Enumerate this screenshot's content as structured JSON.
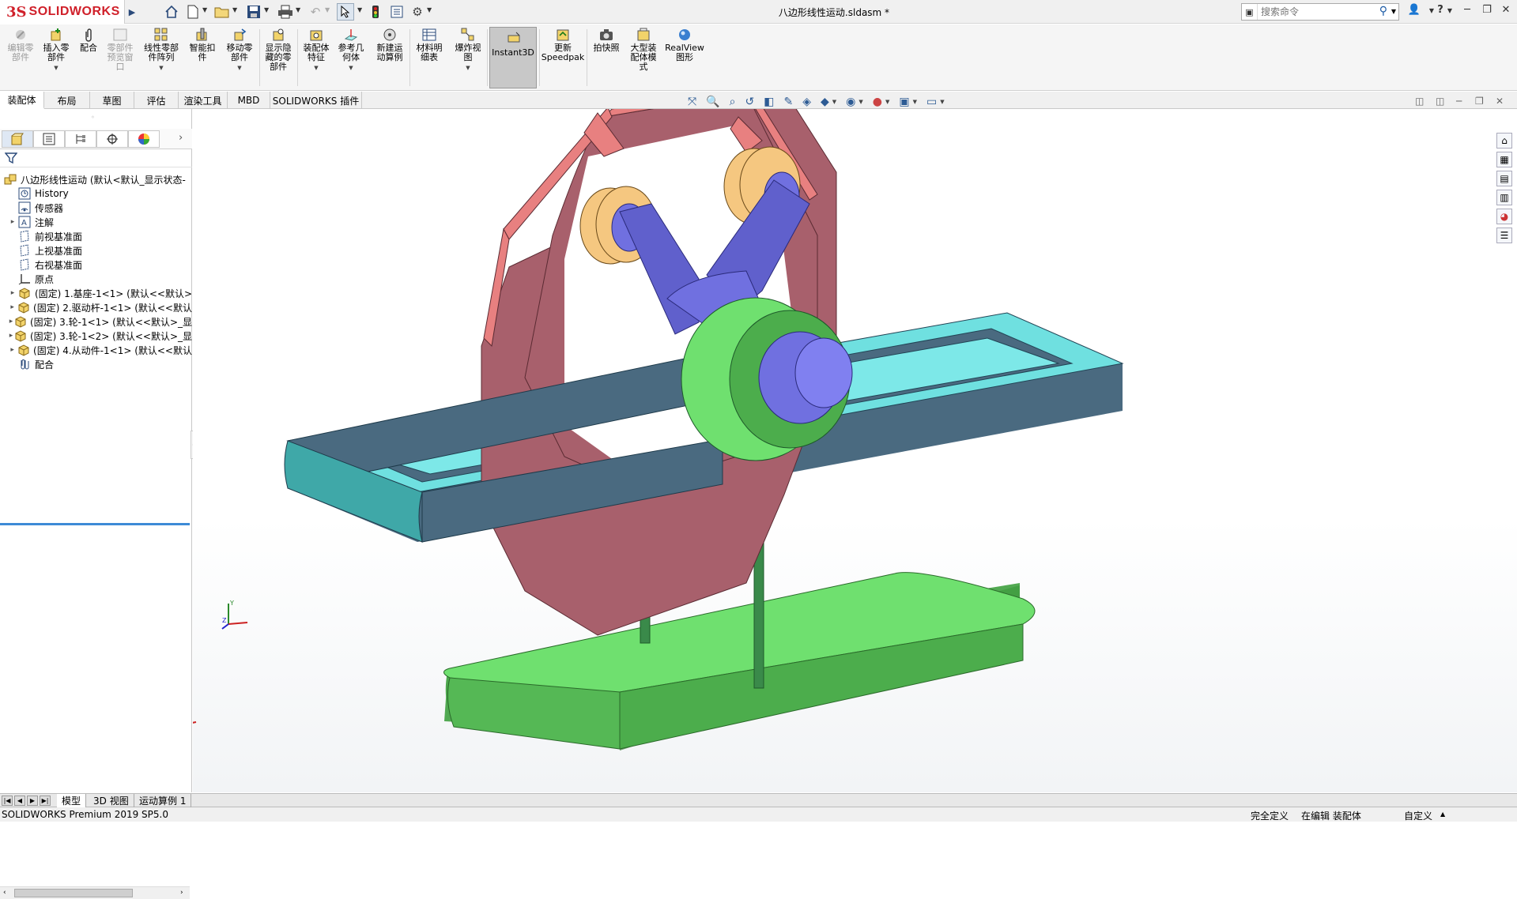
{
  "app": {
    "brand_ds": "3S",
    "brand_name": "SOLIDWORKS"
  },
  "window": {
    "title": "八边形线性运动.sldasm *"
  },
  "search": {
    "placeholder": "搜索命令"
  },
  "commands": [
    {
      "label": "编辑零部件",
      "line1": "编辑零",
      "line2": "部件",
      "enabled": false
    },
    {
      "label": "插入零部件",
      "line1": "插入零",
      "line2": "部件",
      "enabled": true
    },
    {
      "label": "配合",
      "line1": "配合",
      "line2": "",
      "enabled": true
    },
    {
      "label": "零部件预览窗口",
      "line1": "零部件",
      "line2": "预览窗",
      "line3": "口",
      "enabled": false
    },
    {
      "label": "线性零部件阵列",
      "line1": "线性零部",
      "line2": "件阵列",
      "enabled": true
    },
    {
      "label": "智能扣件",
      "line1": "智能扣",
      "line2": "件",
      "enabled": true
    },
    {
      "label": "移动零部件",
      "line1": "移动零",
      "line2": "部件",
      "enabled": true
    },
    {
      "label": "显示隐藏的零部件",
      "line1": "显示隐",
      "line2": "藏的零",
      "line3": "部件",
      "enabled": true
    },
    {
      "label": "装配体特征",
      "line1": "装配体",
      "line2": "特征",
      "enabled": true
    },
    {
      "label": "参考几何体",
      "line1": "参考几",
      "line2": "何体",
      "enabled": true
    },
    {
      "label": "新建运动算例",
      "line1": "新建运",
      "line2": "动算例",
      "enabled": true
    },
    {
      "label": "材料明细表",
      "line1": "材料明",
      "line2": "细表",
      "enabled": true
    },
    {
      "label": "爆炸视图",
      "line1": "爆炸视",
      "line2": "图",
      "enabled": true
    },
    {
      "label": "Instant3D",
      "line1": "Instant3D",
      "line2": "",
      "enabled": true
    },
    {
      "label": "更新Speedpak",
      "line1": "更新",
      "line2": "Speedpak",
      "enabled": true
    },
    {
      "label": "拍快照",
      "line1": "拍快照",
      "line2": "",
      "enabled": true
    },
    {
      "label": "大型装配体模式",
      "line1": "大型装",
      "line2": "配体模",
      "line3": "式",
      "enabled": true
    },
    {
      "label": "RealView图形",
      "line1": "RealView",
      "line2": "图形",
      "enabled": true
    }
  ],
  "ribbon_tabs": [
    "装配体",
    "布局",
    "草图",
    "评估",
    "渲染工具",
    "MBD",
    "SOLIDWORKS 插件"
  ],
  "tree": {
    "root": "八边形线性运动 (默认<默认_显示状态-",
    "items": [
      {
        "label": "History",
        "icon": "history-icon",
        "expand": false
      },
      {
        "label": "传感器",
        "icon": "sensor-icon",
        "expand": false
      },
      {
        "label": "注解",
        "icon": "annotation-icon",
        "expand": true
      },
      {
        "label": "前视基准面",
        "icon": "plane-icon",
        "expand": false
      },
      {
        "label": "上视基准面",
        "icon": "plane-icon",
        "expand": false
      },
      {
        "label": "右视基准面",
        "icon": "plane-icon",
        "expand": false
      },
      {
        "label": "原点",
        "icon": "origin-icon",
        "expand": false
      },
      {
        "label": "(固定) 1.基座-1<1> (默认<<默认>",
        "icon": "part-icon",
        "expand": true
      },
      {
        "label": "(固定) 2.驱动杆-1<1> (默认<<默认",
        "icon": "part-icon",
        "expand": true
      },
      {
        "label": "(固定) 3.轮-1<1> (默认<<默认>_显",
        "icon": "part-icon",
        "expand": true
      },
      {
        "label": "(固定) 3.轮-1<2> (默认<<默认>_显",
        "icon": "part-icon",
        "expand": true
      },
      {
        "label": "(固定) 4.从动件-1<1> (默认<<默认",
        "icon": "part-icon",
        "expand": true
      },
      {
        "label": "配合",
        "icon": "mates-icon",
        "expand": false
      }
    ]
  },
  "bottom_tabs": [
    "模型",
    "3D 视图",
    "运动算例 1"
  ],
  "status": {
    "product": "SOLIDWORKS Premium 2019 SP5.0",
    "definition": "完全定义",
    "editing": "在编辑 装配体",
    "custom": "自定义"
  },
  "colors": {
    "octagon": "#a8606c",
    "octagon_face": "#e88080",
    "rail_top": "#6fe0e0",
    "rail_side": "#4a6a80",
    "hub": "#6fe06f",
    "axle": "#7070e0",
    "roller": "#f5c780",
    "base": "#6fe06f",
    "rod": "#3a8a4a"
  }
}
